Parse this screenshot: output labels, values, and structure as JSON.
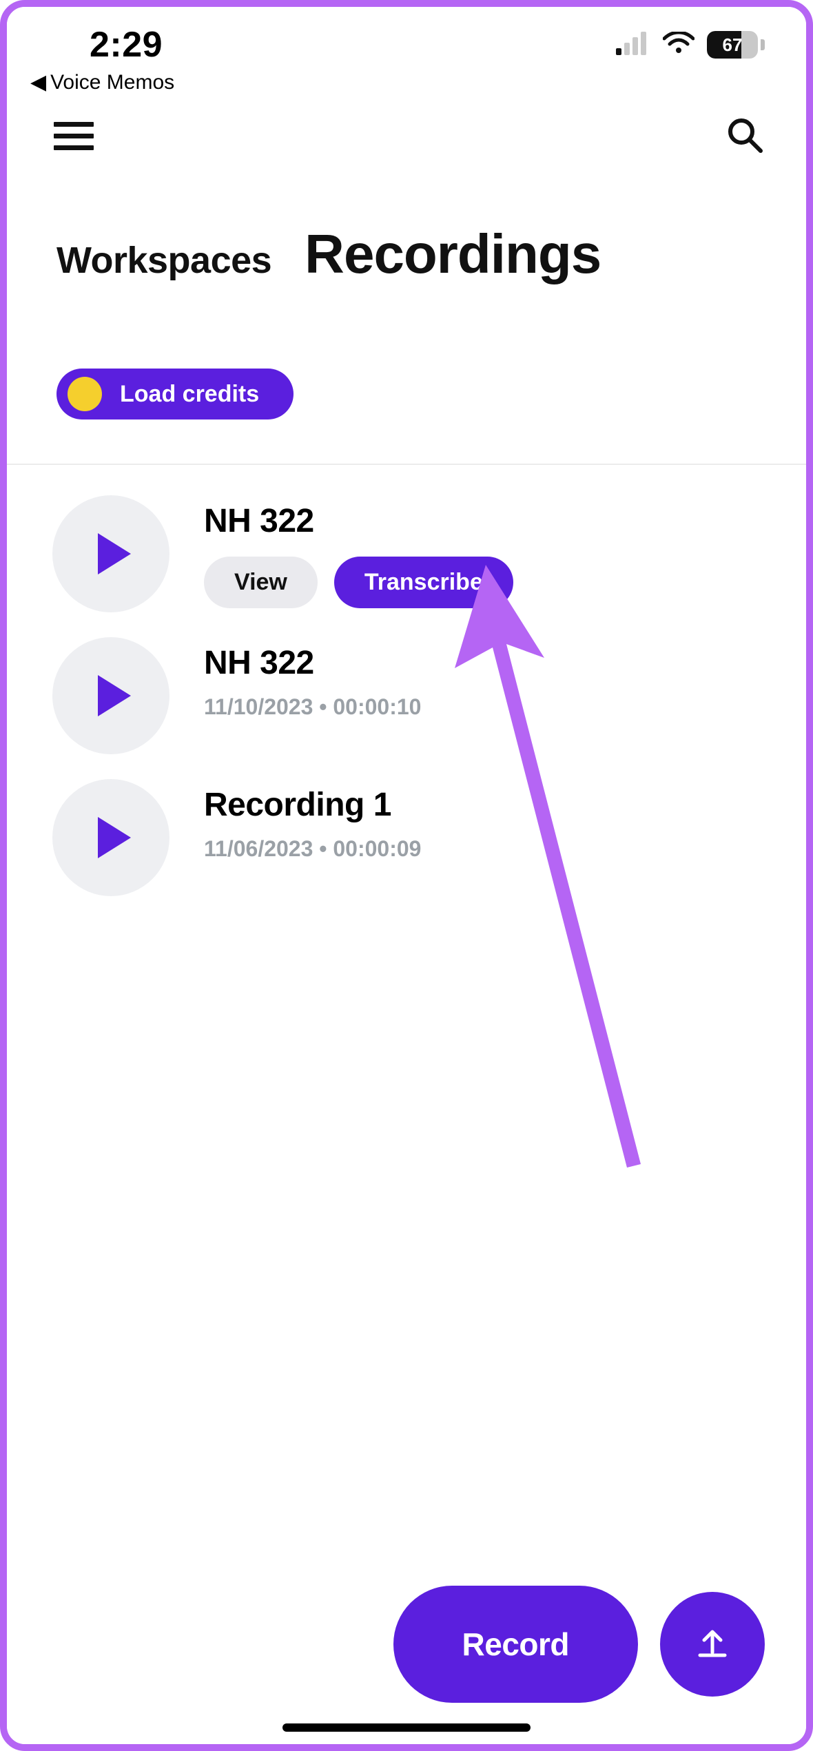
{
  "status": {
    "time": "2:29",
    "back_app": "Voice Memos",
    "battery_level": "67"
  },
  "header": {
    "breadcrumb": "Workspaces",
    "title": "Recordings"
  },
  "credits": {
    "label": "Load credits"
  },
  "recordings": [
    {
      "title": "NH 322",
      "expanded": true,
      "view_label": "View",
      "transcribe_label": "Transcribe"
    },
    {
      "title": "NH 322",
      "meta": "11/10/2023 • 00:00:10"
    },
    {
      "title": "Recording 1",
      "meta": "11/06/2023 • 00:00:09"
    }
  ],
  "actions": {
    "record_label": "Record"
  },
  "colors": {
    "accent": "#5b1fde",
    "annotation": "#b565f4",
    "coin": "#f5cf2d"
  }
}
